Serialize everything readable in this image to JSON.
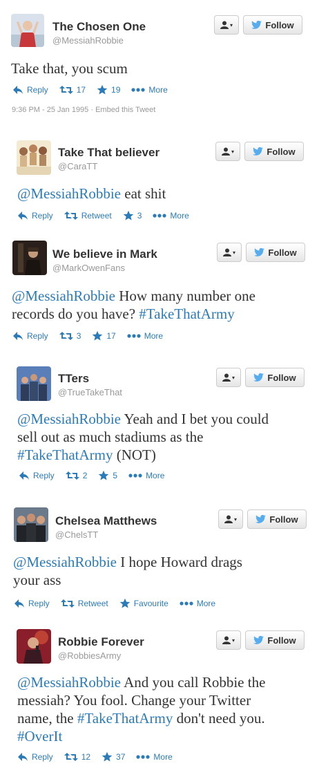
{
  "tweets": [
    {
      "name": "The Chosen One",
      "handle": "@MessiahRobbie",
      "follow_label": "Follow",
      "text": "Take that, you scum",
      "reply_label": "Reply",
      "retweet_value": "17",
      "favorite_value": "19",
      "more_label": "More",
      "timestamp": "9:36 PM - 25 Jan 1995",
      "embed_label": "Embed this Tweet",
      "meta_sep": "·"
    },
    {
      "name": "Take That believer",
      "handle": "@CaraTT",
      "follow_label": "Follow",
      "mention": "@MessiahRobbie",
      "text_rest": " eat shit",
      "reply_label": "Reply",
      "retweet_value": "Retweet",
      "favorite_value": "3",
      "more_label": "More"
    },
    {
      "name": "We believe in Mark",
      "handle": "@MarkOwenFans",
      "follow_label": "Follow",
      "mention": "@MessiahRobbie",
      "line1_rest": " How many number one",
      "line2_plain": "records do you have? ",
      "hashtag": "#TakeThatArmy",
      "reply_label": "Reply",
      "retweet_value": "3",
      "favorite_value": "17",
      "more_label": "More"
    },
    {
      "name": "TTers",
      "handle": "@TrueTakeThat",
      "follow_label": "Follow",
      "mention": "@MessiahRobbie",
      "line1_rest": " Yeah and I bet you could",
      "line2": "sell out as much stadiums as the",
      "hashtag": "#TakeThatArmy",
      "line3_rest": " (NOT)",
      "reply_label": "Reply",
      "retweet_value": "2",
      "favorite_value": "5",
      "more_label": "More"
    },
    {
      "name": "Chelsea Matthews",
      "handle": "@ChelsTT",
      "follow_label": "Follow",
      "mention": "@MessiahRobbie",
      "line1_rest": " I hope Howard drags",
      "line2": "your ass",
      "reply_label": "Reply",
      "retweet_value": "Retweet",
      "favorite_value": "Favourite",
      "more_label": "More"
    },
    {
      "name": "Robbie Forever",
      "handle": "@RobbiesArmy",
      "follow_label": "Follow",
      "mention": "@MessiahRobbie",
      "line1_rest": " And you call Robbie the",
      "line2": "messiah? You fool. Change your Twitter",
      "line3_pre": "name, the ",
      "hashtag": "#TakeThatArmy",
      "line3_rest": " don't need you.",
      "hashtag2": "#OverIt",
      "reply_label": "Reply",
      "retweet_value": "12",
      "favorite_value": "37",
      "more_label": "More"
    }
  ],
  "icons": {
    "reply": "reply-arrow-icon",
    "retweet": "retweet-icon",
    "favorite": "star-icon",
    "more": "more-dots-icon",
    "user": "user-dropdown-icon",
    "bird": "twitter-bird-icon"
  },
  "colors": {
    "link": "#2b7bb9",
    "text": "#333333",
    "muted": "#999999"
  }
}
